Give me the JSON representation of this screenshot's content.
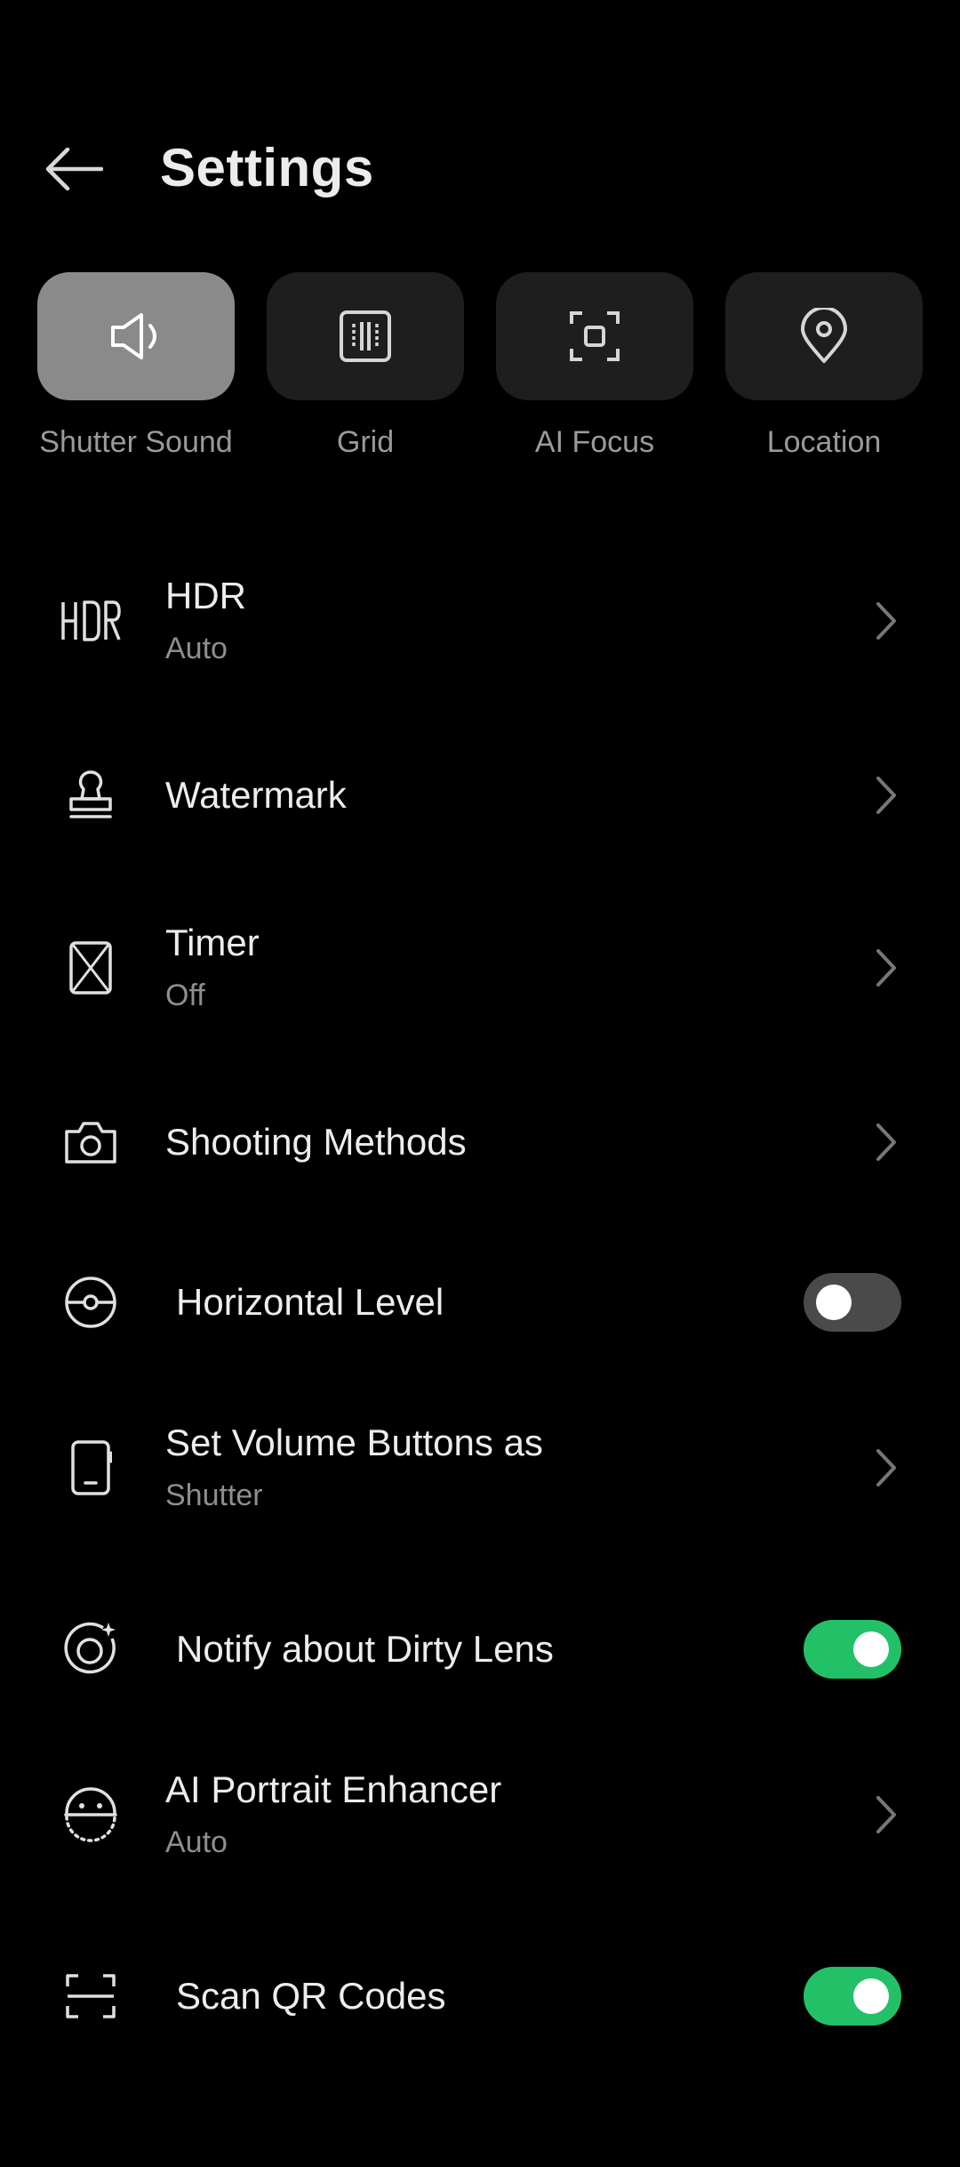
{
  "header": {
    "title": "Settings"
  },
  "quick_tiles": [
    {
      "label": "Shutter Sound",
      "icon": "speaker-icon",
      "active": true
    },
    {
      "label": "Grid",
      "icon": "grid-icon",
      "active": false
    },
    {
      "label": "AI Focus",
      "icon": "focus-frame-icon",
      "active": false
    },
    {
      "label": "Location",
      "icon": "location-pin-icon",
      "active": false
    }
  ],
  "settings": [
    {
      "title": "HDR",
      "subtitle": "Auto",
      "icon": "hdr-icon",
      "control": "chevron"
    },
    {
      "title": "Watermark",
      "icon": "stamp-icon",
      "control": "chevron"
    },
    {
      "title": "Timer",
      "subtitle": "Off",
      "icon": "hourglass-icon",
      "control": "chevron"
    },
    {
      "title": "Shooting Methods",
      "icon": "camera-icon",
      "control": "chevron"
    },
    {
      "title": "Horizontal Level",
      "icon": "level-icon",
      "control": "toggle",
      "on": false
    },
    {
      "title": "Set Volume Buttons as",
      "subtitle": "Shutter",
      "icon": "phone-icon",
      "control": "chevron"
    },
    {
      "title": "Notify about Dirty Lens",
      "icon": "lens-sparkle-icon",
      "control": "toggle",
      "on": true
    },
    {
      "title": "AI Portrait Enhancer",
      "subtitle": "Auto",
      "icon": "face-icon",
      "control": "chevron"
    },
    {
      "title": "Scan QR Codes",
      "icon": "scan-frame-icon",
      "control": "toggle",
      "on": true
    }
  ],
  "colors": {
    "background": "#000000",
    "tile": "#1e1e1e",
    "tile_active": "#8a8a8a",
    "toggle_on": "#22c168",
    "toggle_off": "#4a4a4a"
  }
}
